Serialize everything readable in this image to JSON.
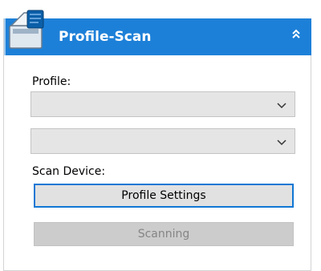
{
  "header": {
    "title": "Profile-Scan",
    "app_icon": "scanner-icon",
    "collapse_icon": "double-chevron-up-icon"
  },
  "form": {
    "profile_label": "Profile:",
    "profile_value": "",
    "second_select_value": "",
    "scan_device_label": "Scan Device:"
  },
  "buttons": {
    "profile_settings": "Profile Settings",
    "scanning": "Scanning"
  },
  "colors": {
    "header_bg": "#1d80d8",
    "primary_border": "#0f77d4",
    "disabled_bg": "#cccccc",
    "disabled_text": "#858585"
  }
}
